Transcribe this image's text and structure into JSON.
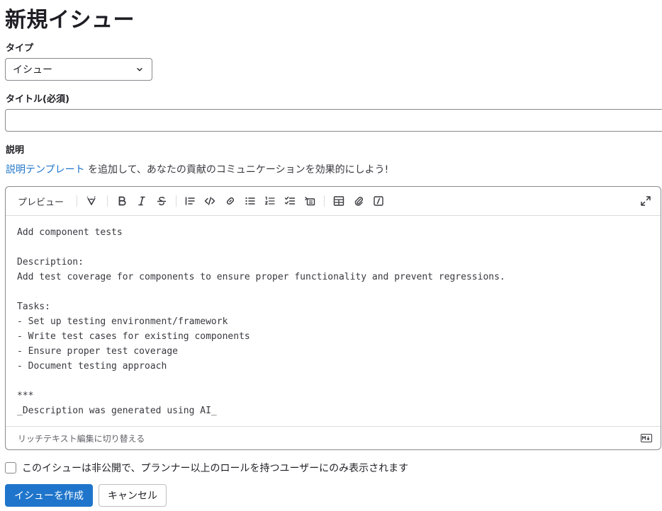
{
  "page": {
    "title": "新規イシュー"
  },
  "type_field": {
    "label": "タイプ",
    "selected": "イシュー"
  },
  "title_field": {
    "label": "タイトル(必須)",
    "value": ""
  },
  "description": {
    "label": "説明",
    "template_link": "説明テンプレート",
    "template_text": " を追加して、あなたの貢献のコミュニケーションを効果的にしよう!"
  },
  "editor": {
    "preview_label": "プレビュー",
    "toolbar_icons": [
      "ai-icon",
      "bold-icon",
      "italic-icon",
      "strikethrough-icon",
      "quote-icon",
      "code-icon",
      "link-icon",
      "bulleted-list-icon",
      "numbered-list-icon",
      "task-list-icon",
      "collapsible-icon",
      "table-icon",
      "attach-icon",
      "slash-command-icon",
      "fullscreen-icon"
    ],
    "content": "Add component tests\n\nDescription:\nAdd test coverage for components to ensure proper functionality and prevent regressions.\n\nTasks:\n- Set up testing environment/framework\n- Write test cases for existing components\n- Ensure proper test coverage\n- Document testing approach\n\n***\n_Description was generated using AI_",
    "switch_label": "リッチテキスト編集に切り替える",
    "markdown_icon": "markdown-icon"
  },
  "confidential": {
    "label": "このイシューは非公開で、プランナー以上のロールを持つユーザーにのみ表示されます",
    "checked": false
  },
  "actions": {
    "create": "イシューを作成",
    "cancel": "キャンセル"
  },
  "colors": {
    "primary": "#1f75cb",
    "link": "#1f75cb",
    "text": "#1f1e24",
    "border": "#89888d"
  }
}
